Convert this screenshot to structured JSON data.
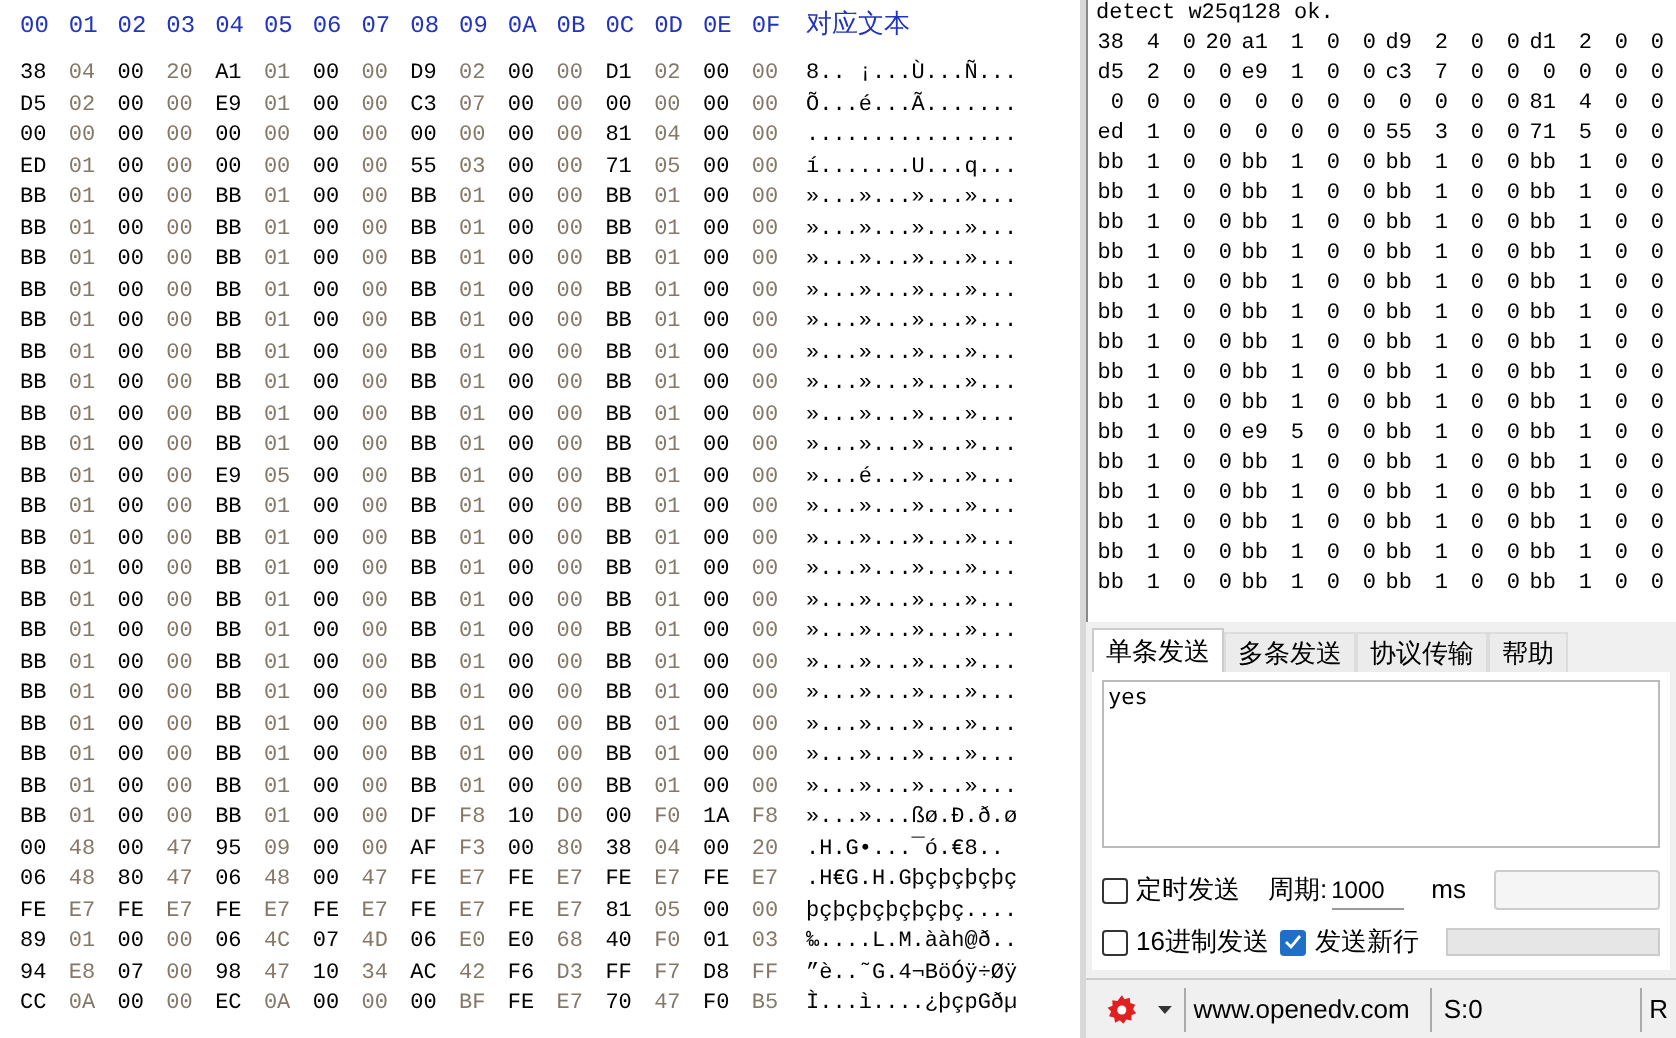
{
  "hex_view": {
    "headers": [
      "00",
      "01",
      "02",
      "03",
      "04",
      "05",
      "06",
      "07",
      "08",
      "09",
      "0A",
      "0B",
      "0C",
      "0D",
      "0E",
      "0F"
    ],
    "text_header": "对应文本",
    "rows": [
      {
        "bytes": [
          "38",
          "04",
          "00",
          "20",
          "A1",
          "01",
          "00",
          "00",
          "D9",
          "02",
          "00",
          "00",
          "D1",
          "02",
          "00",
          "00"
        ],
        "text": "8.. ¡...Ù...Ñ..."
      },
      {
        "bytes": [
          "D5",
          "02",
          "00",
          "00",
          "E9",
          "01",
          "00",
          "00",
          "C3",
          "07",
          "00",
          "00",
          "00",
          "00",
          "00",
          "00"
        ],
        "text": "Õ...é...Ã......."
      },
      {
        "bytes": [
          "00",
          "00",
          "00",
          "00",
          "00",
          "00",
          "00",
          "00",
          "00",
          "00",
          "00",
          "00",
          "81",
          "04",
          "00",
          "00"
        ],
        "text": "................"
      },
      {
        "bytes": [
          "ED",
          "01",
          "00",
          "00",
          "00",
          "00",
          "00",
          "00",
          "55",
          "03",
          "00",
          "00",
          "71",
          "05",
          "00",
          "00"
        ],
        "text": "í.......U...q..."
      },
      {
        "bytes": [
          "BB",
          "01",
          "00",
          "00",
          "BB",
          "01",
          "00",
          "00",
          "BB",
          "01",
          "00",
          "00",
          "BB",
          "01",
          "00",
          "00"
        ],
        "text": "»...»...»...»..."
      },
      {
        "bytes": [
          "BB",
          "01",
          "00",
          "00",
          "BB",
          "01",
          "00",
          "00",
          "BB",
          "01",
          "00",
          "00",
          "BB",
          "01",
          "00",
          "00"
        ],
        "text": "»...»...»...»..."
      },
      {
        "bytes": [
          "BB",
          "01",
          "00",
          "00",
          "BB",
          "01",
          "00",
          "00",
          "BB",
          "01",
          "00",
          "00",
          "BB",
          "01",
          "00",
          "00"
        ],
        "text": "»...»...»...»..."
      },
      {
        "bytes": [
          "BB",
          "01",
          "00",
          "00",
          "BB",
          "01",
          "00",
          "00",
          "BB",
          "01",
          "00",
          "00",
          "BB",
          "01",
          "00",
          "00"
        ],
        "text": "»...»...»...»..."
      },
      {
        "bytes": [
          "BB",
          "01",
          "00",
          "00",
          "BB",
          "01",
          "00",
          "00",
          "BB",
          "01",
          "00",
          "00",
          "BB",
          "01",
          "00",
          "00"
        ],
        "text": "»...»...»...»..."
      },
      {
        "bytes": [
          "BB",
          "01",
          "00",
          "00",
          "BB",
          "01",
          "00",
          "00",
          "BB",
          "01",
          "00",
          "00",
          "BB",
          "01",
          "00",
          "00"
        ],
        "text": "»...»...»...»..."
      },
      {
        "bytes": [
          "BB",
          "01",
          "00",
          "00",
          "BB",
          "01",
          "00",
          "00",
          "BB",
          "01",
          "00",
          "00",
          "BB",
          "01",
          "00",
          "00"
        ],
        "text": "»...»...»...»..."
      },
      {
        "bytes": [
          "BB",
          "01",
          "00",
          "00",
          "BB",
          "01",
          "00",
          "00",
          "BB",
          "01",
          "00",
          "00",
          "BB",
          "01",
          "00",
          "00"
        ],
        "text": "»...»...»...»..."
      },
      {
        "bytes": [
          "BB",
          "01",
          "00",
          "00",
          "BB",
          "01",
          "00",
          "00",
          "BB",
          "01",
          "00",
          "00",
          "BB",
          "01",
          "00",
          "00"
        ],
        "text": "»...»...»...»..."
      },
      {
        "bytes": [
          "BB",
          "01",
          "00",
          "00",
          "E9",
          "05",
          "00",
          "00",
          "BB",
          "01",
          "00",
          "00",
          "BB",
          "01",
          "00",
          "00"
        ],
        "text": "»...é...»...»..."
      },
      {
        "bytes": [
          "BB",
          "01",
          "00",
          "00",
          "BB",
          "01",
          "00",
          "00",
          "BB",
          "01",
          "00",
          "00",
          "BB",
          "01",
          "00",
          "00"
        ],
        "text": "»...»...»...»..."
      },
      {
        "bytes": [
          "BB",
          "01",
          "00",
          "00",
          "BB",
          "01",
          "00",
          "00",
          "BB",
          "01",
          "00",
          "00",
          "BB",
          "01",
          "00",
          "00"
        ],
        "text": "»...»...»...»..."
      },
      {
        "bytes": [
          "BB",
          "01",
          "00",
          "00",
          "BB",
          "01",
          "00",
          "00",
          "BB",
          "01",
          "00",
          "00",
          "BB",
          "01",
          "00",
          "00"
        ],
        "text": "»...»...»...»..."
      },
      {
        "bytes": [
          "BB",
          "01",
          "00",
          "00",
          "BB",
          "01",
          "00",
          "00",
          "BB",
          "01",
          "00",
          "00",
          "BB",
          "01",
          "00",
          "00"
        ],
        "text": "»...»...»...»..."
      },
      {
        "bytes": [
          "BB",
          "01",
          "00",
          "00",
          "BB",
          "01",
          "00",
          "00",
          "BB",
          "01",
          "00",
          "00",
          "BB",
          "01",
          "00",
          "00"
        ],
        "text": "»...»...»...»..."
      },
      {
        "bytes": [
          "BB",
          "01",
          "00",
          "00",
          "BB",
          "01",
          "00",
          "00",
          "BB",
          "01",
          "00",
          "00",
          "BB",
          "01",
          "00",
          "00"
        ],
        "text": "»...»...»...»..."
      },
      {
        "bytes": [
          "BB",
          "01",
          "00",
          "00",
          "BB",
          "01",
          "00",
          "00",
          "BB",
          "01",
          "00",
          "00",
          "BB",
          "01",
          "00",
          "00"
        ],
        "text": "»...»...»...»..."
      },
      {
        "bytes": [
          "BB",
          "01",
          "00",
          "00",
          "BB",
          "01",
          "00",
          "00",
          "BB",
          "01",
          "00",
          "00",
          "BB",
          "01",
          "00",
          "00"
        ],
        "text": "»...»...»...»..."
      },
      {
        "bytes": [
          "BB",
          "01",
          "00",
          "00",
          "BB",
          "01",
          "00",
          "00",
          "BB",
          "01",
          "00",
          "00",
          "BB",
          "01",
          "00",
          "00"
        ],
        "text": "»...»...»...»..."
      },
      {
        "bytes": [
          "BB",
          "01",
          "00",
          "00",
          "BB",
          "01",
          "00",
          "00",
          "BB",
          "01",
          "00",
          "00",
          "BB",
          "01",
          "00",
          "00"
        ],
        "text": "»...»...»...»..."
      },
      {
        "bytes": [
          "BB",
          "01",
          "00",
          "00",
          "BB",
          "01",
          "00",
          "00",
          "DF",
          "F8",
          "10",
          "D0",
          "00",
          "F0",
          "1A",
          "F8"
        ],
        "text": "»...»...ßø.Ð.ð.ø"
      },
      {
        "bytes": [
          "00",
          "48",
          "00",
          "47",
          "95",
          "09",
          "00",
          "00",
          "AF",
          "F3",
          "00",
          "80",
          "38",
          "04",
          "00",
          "20"
        ],
        "text": ".H.G•...¯ó.€8.."
      },
      {
        "bytes": [
          "06",
          "48",
          "80",
          "47",
          "06",
          "48",
          "00",
          "47",
          "FE",
          "E7",
          "FE",
          "E7",
          "FE",
          "E7",
          "FE",
          "E7"
        ],
        "text": ".H€G.H.Gþçþçþçþç"
      },
      {
        "bytes": [
          "FE",
          "E7",
          "FE",
          "E7",
          "FE",
          "E7",
          "FE",
          "E7",
          "FE",
          "E7",
          "FE",
          "E7",
          "81",
          "05",
          "00",
          "00"
        ],
        "text": "þçþçþçþçþçþç...."
      },
      {
        "bytes": [
          "89",
          "01",
          "00",
          "00",
          "06",
          "4C",
          "07",
          "4D",
          "06",
          "E0",
          "E0",
          "68",
          "40",
          "F0",
          "01",
          "03"
        ],
        "text": "‰....L.M.ààh@ð.."
      },
      {
        "bytes": [
          "94",
          "E8",
          "07",
          "00",
          "98",
          "47",
          "10",
          "34",
          "AC",
          "42",
          "F6",
          "D3",
          "FF",
          "F7",
          "D8",
          "FF"
        ],
        "text": "”è..˜G.4¬BöÓÿ÷Øÿ"
      },
      {
        "bytes": [
          "CC",
          "0A",
          "00",
          "00",
          "EC",
          "0A",
          "00",
          "00",
          "00",
          "BF",
          "FE",
          "E7",
          "70",
          "47",
          "F0",
          "B5"
        ],
        "text": "Ì...ì....¿þçpGðµ"
      }
    ]
  },
  "terminal": {
    "first_line": "detect w25q128 ok.",
    "rows": [
      [
        "38",
        "4",
        "0",
        "20",
        "a1",
        "1",
        "0",
        "0",
        "d9",
        "2",
        "0",
        "0",
        "d1",
        "2",
        "0",
        "0"
      ],
      [
        "d5",
        "2",
        "0",
        "0",
        "e9",
        "1",
        "0",
        "0",
        "c3",
        "7",
        "0",
        "0",
        "0",
        "0",
        "0",
        "0"
      ],
      [
        "0",
        "0",
        "0",
        "0",
        "0",
        "0",
        "0",
        "0",
        "0",
        "0",
        "0",
        "0",
        "81",
        "4",
        "0",
        "0"
      ],
      [
        "ed",
        "1",
        "0",
        "0",
        "0",
        "0",
        "0",
        "0",
        "55",
        "3",
        "0",
        "0",
        "71",
        "5",
        "0",
        "0"
      ],
      [
        "bb",
        "1",
        "0",
        "0",
        "bb",
        "1",
        "0",
        "0",
        "bb",
        "1",
        "0",
        "0",
        "bb",
        "1",
        "0",
        "0"
      ],
      [
        "bb",
        "1",
        "0",
        "0",
        "bb",
        "1",
        "0",
        "0",
        "bb",
        "1",
        "0",
        "0",
        "bb",
        "1",
        "0",
        "0"
      ],
      [
        "bb",
        "1",
        "0",
        "0",
        "bb",
        "1",
        "0",
        "0",
        "bb",
        "1",
        "0",
        "0",
        "bb",
        "1",
        "0",
        "0"
      ],
      [
        "bb",
        "1",
        "0",
        "0",
        "bb",
        "1",
        "0",
        "0",
        "bb",
        "1",
        "0",
        "0",
        "bb",
        "1",
        "0",
        "0"
      ],
      [
        "bb",
        "1",
        "0",
        "0",
        "bb",
        "1",
        "0",
        "0",
        "bb",
        "1",
        "0",
        "0",
        "bb",
        "1",
        "0",
        "0"
      ],
      [
        "bb",
        "1",
        "0",
        "0",
        "bb",
        "1",
        "0",
        "0",
        "bb",
        "1",
        "0",
        "0",
        "bb",
        "1",
        "0",
        "0"
      ],
      [
        "bb",
        "1",
        "0",
        "0",
        "bb",
        "1",
        "0",
        "0",
        "bb",
        "1",
        "0",
        "0",
        "bb",
        "1",
        "0",
        "0"
      ],
      [
        "bb",
        "1",
        "0",
        "0",
        "bb",
        "1",
        "0",
        "0",
        "bb",
        "1",
        "0",
        "0",
        "bb",
        "1",
        "0",
        "0"
      ],
      [
        "bb",
        "1",
        "0",
        "0",
        "bb",
        "1",
        "0",
        "0",
        "bb",
        "1",
        "0",
        "0",
        "bb",
        "1",
        "0",
        "0"
      ],
      [
        "bb",
        "1",
        "0",
        "0",
        "e9",
        "5",
        "0",
        "0",
        "bb",
        "1",
        "0",
        "0",
        "bb",
        "1",
        "0",
        "0"
      ],
      [
        "bb",
        "1",
        "0",
        "0",
        "bb",
        "1",
        "0",
        "0",
        "bb",
        "1",
        "0",
        "0",
        "bb",
        "1",
        "0",
        "0"
      ],
      [
        "bb",
        "1",
        "0",
        "0",
        "bb",
        "1",
        "0",
        "0",
        "bb",
        "1",
        "0",
        "0",
        "bb",
        "1",
        "0",
        "0"
      ],
      [
        "bb",
        "1",
        "0",
        "0",
        "bb",
        "1",
        "0",
        "0",
        "bb",
        "1",
        "0",
        "0",
        "bb",
        "1",
        "0",
        "0"
      ],
      [
        "bb",
        "1",
        "0",
        "0",
        "bb",
        "1",
        "0",
        "0",
        "bb",
        "1",
        "0",
        "0",
        "bb",
        "1",
        "0",
        "0"
      ],
      [
        "bb",
        "1",
        "0",
        "0",
        "bb",
        "1",
        "0",
        "0",
        "bb",
        "1",
        "0",
        "0",
        "bb",
        "1",
        "0",
        "0"
      ]
    ]
  },
  "send_tabs": [
    {
      "label": "单条发送",
      "selected": true
    },
    {
      "label": "多条发送",
      "selected": false
    },
    {
      "label": "协议传输",
      "selected": false
    },
    {
      "label": "帮助",
      "selected": false
    }
  ],
  "send_box": {
    "value": "yes"
  },
  "options": {
    "timed_send": {
      "label": "定时发送",
      "checked": false
    },
    "period_label": "周期:",
    "period_value": "1000",
    "period_unit": "ms",
    "hex_send": {
      "label": "16进制发送",
      "checked": false
    },
    "send_newline": {
      "label": "发送新行",
      "checked": true
    }
  },
  "status_bar": {
    "link": "www.openedv.com",
    "sent": "S:0",
    "received": "R"
  }
}
